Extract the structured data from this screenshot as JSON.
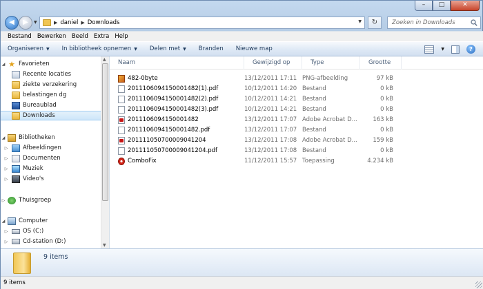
{
  "address": {
    "segments": [
      "daniel",
      "Downloads"
    ],
    "search_placeholder": "Zoeken in Downloads"
  },
  "menu": [
    {
      "underline": "B",
      "rest": "estand"
    },
    {
      "underline": "",
      "pre": "Be",
      "mid": "w",
      "rest": "erken"
    },
    {
      "underline": "",
      "pre": "Bee",
      "mid": "l",
      "rest": "d"
    },
    {
      "underline": "E",
      "rest": "xtra"
    },
    {
      "underline": "H",
      "rest": "elp"
    }
  ],
  "menu_labels": [
    "Bestand",
    "Bewerken",
    "Beeld",
    "Extra",
    "Help"
  ],
  "commands": {
    "organize": "Organiseren",
    "library": "In bibliotheek opnemen",
    "share": "Delen met",
    "burn": "Branden",
    "new_folder": "Nieuwe map"
  },
  "nav": {
    "favorites": "Favorieten",
    "recent": "Recente locaties",
    "folder1": "ziekte verzekering",
    "folder2": "belastingen dg",
    "desktop": "Bureaublad",
    "downloads": "Downloads",
    "libraries": "Bibliotheken",
    "pictures": "Afbeeldingen",
    "documents": "Documenten",
    "music": "Muziek",
    "videos": "Video's",
    "homegroup": "Thuisgroep",
    "computer": "Computer",
    "drive_c": "OS (C:)",
    "drive_d": "Cd-station (D:)"
  },
  "columns": {
    "name": "Naam",
    "date": "Gewijzigd op",
    "type": "Type",
    "size": "Grootte"
  },
  "files": [
    {
      "icon": "png-icon",
      "name": "482-0byte",
      "date": "13/12/2011 17:11",
      "type": "PNG-afbeelding",
      "size": "97 kB"
    },
    {
      "icon": "file-icon",
      "name": "2011106094150001482(1).pdf",
      "date": "10/12/2011 14:20",
      "type": "Bestand",
      "size": "0 kB"
    },
    {
      "icon": "file-icon",
      "name": "2011106094150001482(2).pdf",
      "date": "10/12/2011 14:21",
      "type": "Bestand",
      "size": "0 kB"
    },
    {
      "icon": "file-icon",
      "name": "2011106094150001482(3).pdf",
      "date": "10/12/2011 14:21",
      "type": "Bestand",
      "size": "0 kB"
    },
    {
      "icon": "pdf-icon",
      "name": "2011106094150001482",
      "date": "13/12/2011 17:07",
      "type": "Adobe Acrobat D...",
      "size": "163 kB"
    },
    {
      "icon": "file-icon",
      "name": "2011106094150001482.pdf",
      "date": "13/12/2011 17:07",
      "type": "Bestand",
      "size": "0 kB"
    },
    {
      "icon": "pdf-icon",
      "name": "201111050700009041204",
      "date": "13/12/2011 17:08",
      "type": "Adobe Acrobat D...",
      "size": "159 kB"
    },
    {
      "icon": "file-icon",
      "name": "201111050700009041204.pdf",
      "date": "13/12/2011 17:08",
      "type": "Bestand",
      "size": "0 kB"
    },
    {
      "icon": "app-icon",
      "name": "ComboFix",
      "date": "11/12/2011 15:57",
      "type": "Toepassing",
      "size": "4.234 kB"
    }
  ],
  "details": {
    "count": "9 items"
  },
  "status": {
    "text": "9 items"
  }
}
